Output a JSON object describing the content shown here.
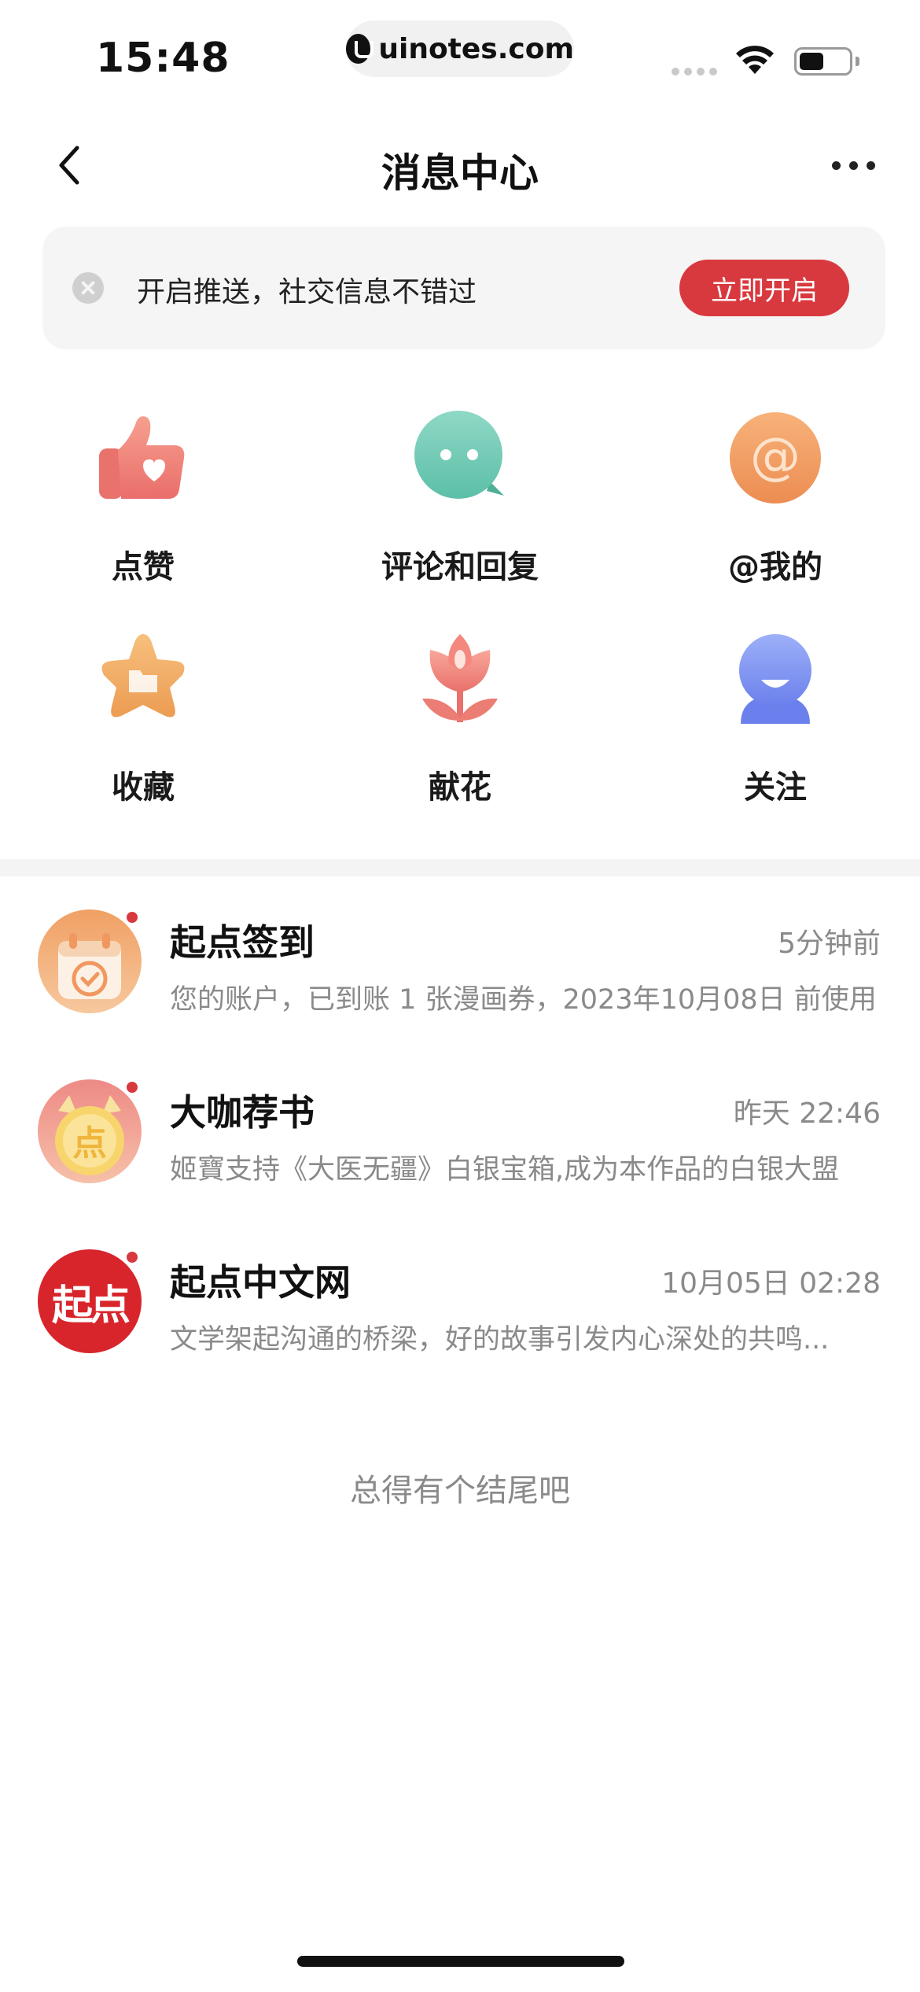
{
  "status_bar": {
    "time": "15:48",
    "url": "uinotes.com"
  },
  "nav": {
    "title": "消息中心",
    "back_icon": "chevron-left-icon",
    "more_icon": "more-horizontal-icon"
  },
  "banner": {
    "text": "开启推送，社交信息不错过",
    "button": "立即开启"
  },
  "categories": [
    {
      "label": "点赞",
      "icon": "thumbs-up-icon"
    },
    {
      "label": "评论和回复",
      "icon": "comment-bubble-icon"
    },
    {
      "label": "@我的",
      "icon": "at-sign-icon"
    },
    {
      "label": "收藏",
      "icon": "star-folder-icon"
    },
    {
      "label": "献花",
      "icon": "flower-icon"
    },
    {
      "label": "关注",
      "icon": "user-follow-icon"
    }
  ],
  "messages": [
    {
      "title": "起点签到",
      "time": "5分钟前",
      "preview": "您的账户，已到账 1 张漫画券，2023年10月08日 前使用",
      "unread": true
    },
    {
      "title": "大咖荐书",
      "time": "昨天 22:46",
      "preview": "姬寶支持《大医无疆》白银宝箱,成为本作品的白银大盟",
      "unread": true
    },
    {
      "title": "起点中文网",
      "time": "10月05日 02:28",
      "preview": "文学架起沟通的桥梁，好的故事引发内心深处的共鸣...",
      "unread": true,
      "avatar_text": "起点"
    }
  ],
  "footer_text": "总得有个结尾吧",
  "colors": {
    "accent": "#d8393e",
    "banner_bg": "#f5f5f5",
    "secondary_text": "#8a8a8a"
  }
}
